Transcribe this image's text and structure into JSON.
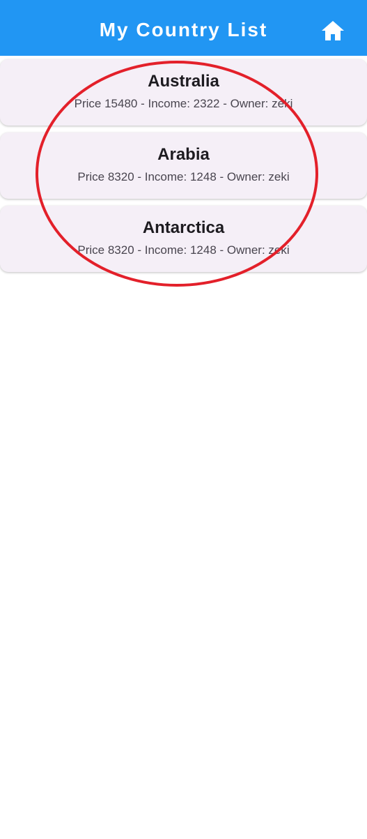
{
  "app_bar": {
    "title": "My Country List",
    "home_icon": "home-icon",
    "background_color": "#2196F3"
  },
  "countries": [
    {
      "name": "Australia",
      "info": "Price 15480 - Income: 2322 - Owner: zeki"
    },
    {
      "name": "Arabia",
      "info": "Price 8320 - Income: 1248 - Owner: zeki"
    },
    {
      "name": "Antarctica",
      "info": "Price 8320 - Income: 1248 - Owner: zeki"
    }
  ],
  "annotation": {
    "shape": "ellipse",
    "color": "#e3202a"
  }
}
